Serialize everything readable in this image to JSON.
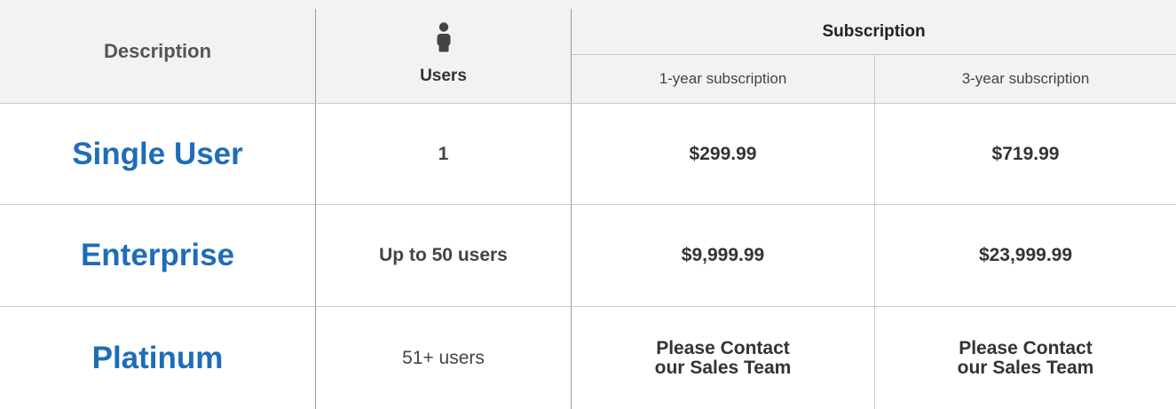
{
  "header": {
    "description_label": "Description",
    "users_label": "Users",
    "users_icon": "user-icon",
    "subscription_label": "Subscription",
    "term_1_label": "1-year subscription",
    "term_3_label": "3-year subscription"
  },
  "plans": [
    {
      "name": "Single User",
      "users": "1",
      "price_1yr": "$299.99",
      "price_3yr": "$719.99"
    },
    {
      "name": "Enterprise",
      "users": "Up to 50 users",
      "price_1yr": "$9,999.99",
      "price_3yr": "$23,999.99"
    },
    {
      "name": "Platinum",
      "users": "51+ users",
      "price_1yr": "Please Contact\nour Sales Team",
      "price_3yr": "Please Contact\nour Sales Team"
    }
  ],
  "colors": {
    "plan_name": "#1f6db8",
    "header_background": "#f2f2f2",
    "text": "#444444",
    "divider": "#9a9a9a"
  }
}
